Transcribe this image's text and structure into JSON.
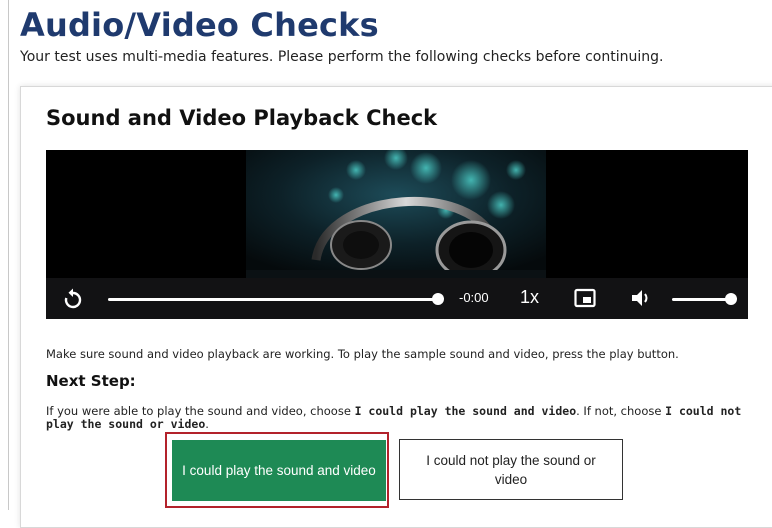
{
  "header": {
    "title": "Audio/Video Checks",
    "subtitle": "Your test uses multi-media features. Please perform the following checks before continuing."
  },
  "check": {
    "title": "Sound and Video Playback Check",
    "player": {
      "time": "-0:00",
      "speed": "1x",
      "progress": 1.0,
      "volume": 1.0,
      "icons": [
        "replay-icon",
        "picture-in-picture-icon",
        "volume-icon"
      ]
    },
    "instructions": "Make sure sound and video playback are working. To play the sample sound and video, press the play button.",
    "next_step_heading": "Next Step:",
    "next_step": {
      "part1": "If you were able to play the sound and video, choose ",
      "bold1": "I could play the sound and video",
      "part2": ". If not, choose ",
      "bold2": "I could not play the sound or video",
      "part3": "."
    },
    "buttons": {
      "yes": "I could play the sound and video",
      "no": "I could not play the sound or video"
    }
  },
  "colors": {
    "title": "#1f3a6e",
    "confirm_button": "#1e8a55",
    "focus_outline": "#b3222b"
  }
}
